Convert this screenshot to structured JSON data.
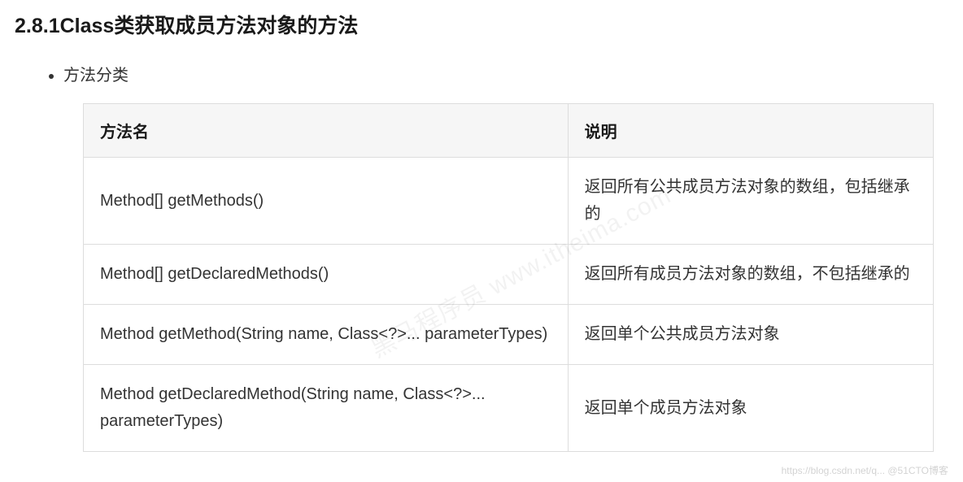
{
  "heading": "2.8.1Class类获取成员方法对象的方法",
  "bullet": "方法分类",
  "table": {
    "headers": {
      "method": "方法名",
      "desc": "说明"
    },
    "rows": [
      {
        "method": "Method[] getMethods()",
        "desc": "返回所有公共成员方法对象的数组，包括继承的"
      },
      {
        "method": "Method[] getDeclaredMethods()",
        "desc": "返回所有成员方法对象的数组，不包括继承的"
      },
      {
        "method": "Method getMethod(String name, Class<?>... parameterTypes)",
        "desc": "返回单个公共成员方法对象"
      },
      {
        "method": "Method getDeclaredMethod(String name, Class<?>... parameterTypes)",
        "desc": "返回单个成员方法对象"
      }
    ]
  },
  "watermark": {
    "center": "黑马程序员  www.itheima.com",
    "bottom_right": "https://blog.csdn.net/q... @51CTO博客"
  }
}
